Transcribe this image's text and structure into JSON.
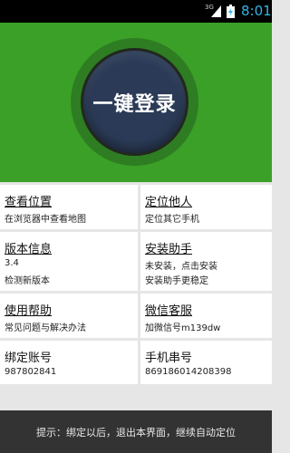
{
  "status_bar": {
    "network": "3G",
    "time": "8:01",
    "signal_icon": "signal-bars-icon",
    "battery_icon": "battery-charging-icon"
  },
  "login_button": {
    "label": "一键登录"
  },
  "grid": {
    "view_location": {
      "title": "查看位置",
      "lines": [
        "在浏览器中查看地图"
      ]
    },
    "locate_others": {
      "title": "定位他人",
      "lines": [
        "定位其它手机"
      ]
    },
    "version_info": {
      "title": "版本信息",
      "lines": [
        "3.4",
        "检测新版本"
      ]
    },
    "install_helper": {
      "title": "安装助手",
      "lines": [
        "未安装，点击安装",
        "安装助手更稳定"
      ]
    },
    "help": {
      "title": "使用帮助",
      "lines": [
        "常见问题与解决办法"
      ]
    },
    "wechat_service": {
      "title": "微信客服",
      "lines": [
        "加微信号m139dw"
      ]
    },
    "bound_account": {
      "title": "绑定账号",
      "lines": [
        "987802841"
      ]
    },
    "phone_serial": {
      "title": "手机串号",
      "lines": [
        "869186014208398"
      ]
    }
  },
  "footer": {
    "tip": "提示：绑定以后，退出本界面，继续自动定位"
  },
  "colors": {
    "header_green": "#3aa027",
    "button_navy": "#2b3b57",
    "footer_bg": "#333333",
    "time_blue": "#33b5e5"
  }
}
